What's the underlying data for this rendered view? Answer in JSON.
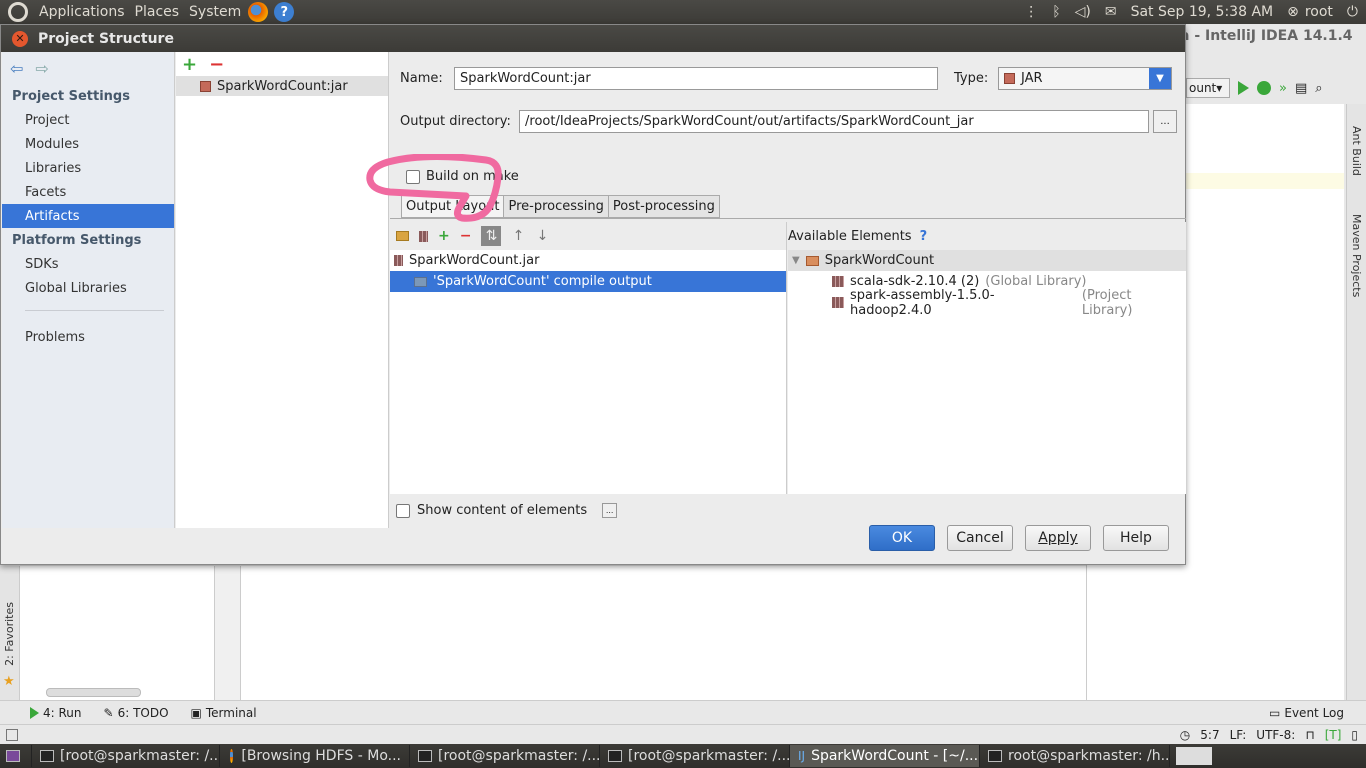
{
  "top_panel": {
    "menus": [
      "Applications",
      "Places",
      "System"
    ],
    "clock": "Sat Sep 19,  5:38 AM",
    "user": "root"
  },
  "ide": {
    "title": "a - IntelliJ IDEA 14.1.4",
    "run_config": "ount",
    "right_tools": [
      "Ant Build",
      "Maven Projects"
    ],
    "left_tools": [
      "2: Favorites"
    ],
    "bottom_tools": [
      "4: Run",
      "6: TODO",
      "Terminal"
    ],
    "event_log": "Event Log",
    "status": {
      "position": "5:7",
      "line_sep": "LF:",
      "encoding": "UTF-8:"
    }
  },
  "dialog": {
    "title": "Project Structure",
    "sidebar": {
      "project_settings": "Project Settings",
      "project_items": [
        "Project",
        "Modules",
        "Libraries",
        "Facets",
        "Artifacts"
      ],
      "platform_settings": "Platform Settings",
      "platform_items": [
        "SDKs",
        "Global Libraries"
      ],
      "problems": "Problems"
    },
    "artifacts": [
      "SparkWordCount:jar"
    ],
    "name_label": "Name:",
    "name_value": "SparkWordCount:jar",
    "type_label": "Type:",
    "type_value": "JAR",
    "output_dir_label": "Output directory:",
    "output_dir_value": "/root/IdeaProjects/SparkWordCount/out/artifacts/SparkWordCount_jar",
    "build_on_make": "Build on make",
    "tabs": [
      "Output Layout",
      "Pre-processing",
      "Post-processing"
    ],
    "layout_tree": {
      "root": "SparkWordCount.jar",
      "child": "'SparkWordCount' compile output"
    },
    "available": {
      "title": "Available Elements",
      "help": "?",
      "module": "SparkWordCount",
      "libs": [
        {
          "name": "scala-sdk-2.10.4 (2)",
          "kind": "(Global Library)"
        },
        {
          "name": "spark-assembly-1.5.0-hadoop2.4.0",
          "kind": "(Project Library)"
        }
      ]
    },
    "show_content": "Show content of elements",
    "buttons": {
      "ok": "OK",
      "cancel": "Cancel",
      "apply": "Apply",
      "help": "Help"
    }
  },
  "taskbar": [
    "[root@sparkmaster: /...",
    "[Browsing HDFS - Mo...",
    "[root@sparkmaster: /...",
    "[root@sparkmaster: /...",
    "SparkWordCount - [~/...",
    "root@sparkmaster: /h..."
  ],
  "colors": {
    "selection": "#3875d7",
    "annotation": "#f06aa0"
  }
}
